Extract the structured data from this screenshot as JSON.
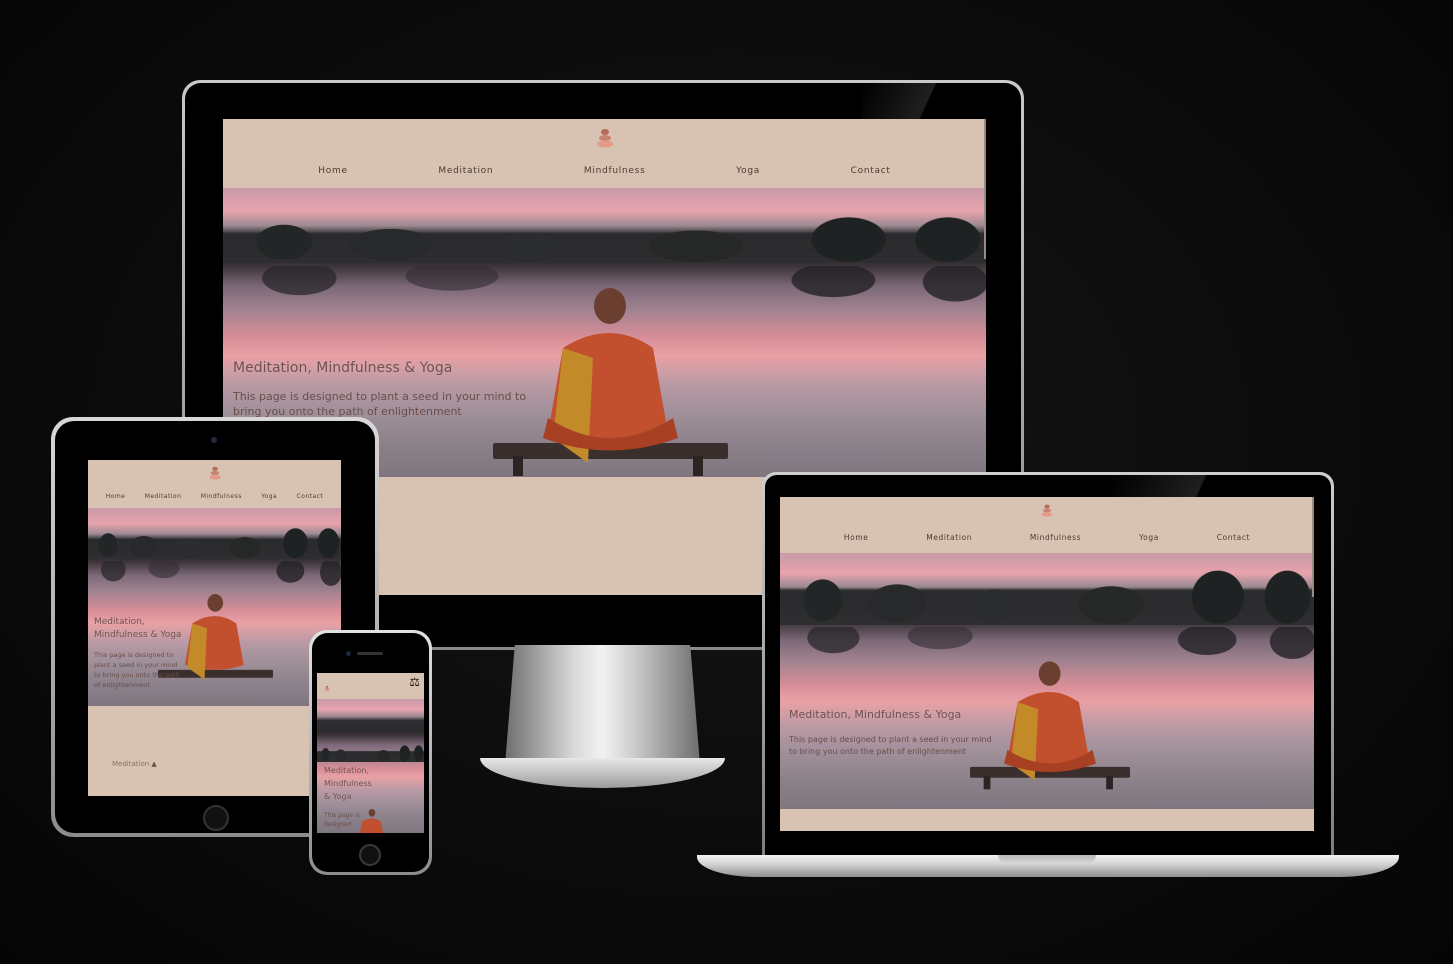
{
  "site": {
    "hero_title": "Meditation, Mindfulness & Yoga",
    "hero_title_wrap_line1": "Meditation,",
    "hero_title_wrap_line2": "Mindfulness & Yoga",
    "hero_title_phone_line1": "Meditation,",
    "hero_title_phone_line2": "Mindfulness",
    "hero_title_phone_line3": "& Yoga",
    "hero_text": "This page is designed to plant a seed in your mind to bring you onto the path of enlightenment",
    "hero_text_tablet": "This page is designed to plant a seed in your mind to bring you onto the path of enlightenment",
    "hero_text_phone": "This page is designed",
    "nav": {
      "home": "Home",
      "meditation": "Meditation",
      "mindfulness": "Mindfulness",
      "yoga": "Yoga",
      "contact": "Contact"
    },
    "tablet_footer_label": "Meditation"
  },
  "colors": {
    "page_bg": "#d8c3b2",
    "nav_text": "#4a3b35",
    "hero_title": "#6e5350",
    "robe": "#c2502e"
  },
  "icons": {
    "logo": "stacked-stones-icon",
    "hamburger": "balance-scale-icon",
    "footer_icon": "meditation-icon"
  }
}
